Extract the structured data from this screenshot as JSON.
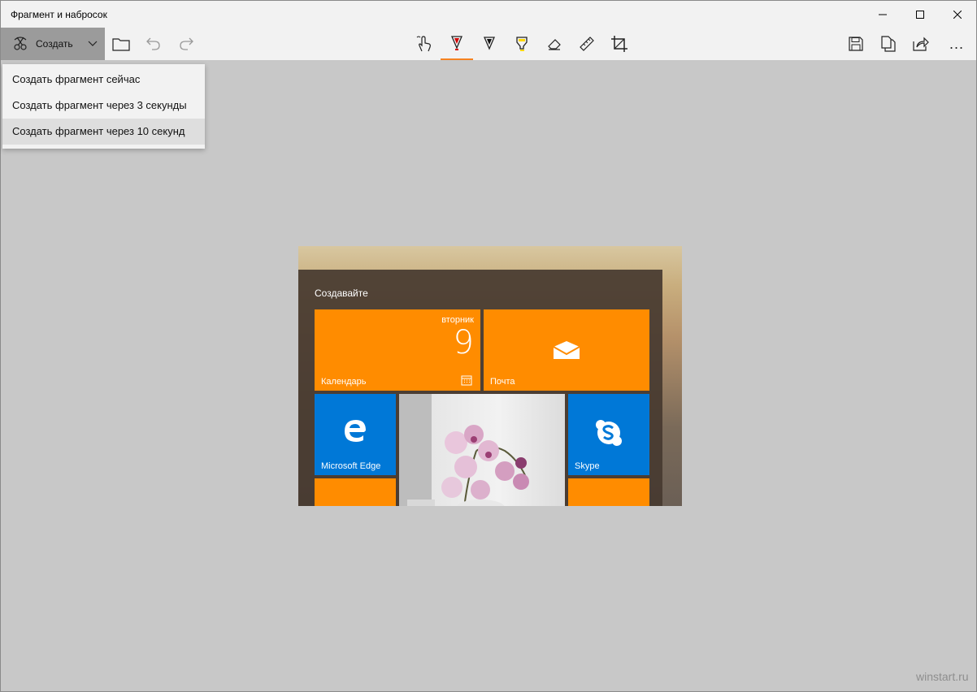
{
  "window": {
    "title": "Фрагмент и набросок"
  },
  "toolbar": {
    "create_label": "Создать",
    "more_label": "..."
  },
  "dropdown": {
    "items": [
      {
        "label": "Создать фрагмент сейчас"
      },
      {
        "label": "Создать фрагмент через 3 секунды"
      },
      {
        "label": "Создать фрагмент через 10 секунд"
      }
    ]
  },
  "snip": {
    "header": "Создавайте",
    "tiles": {
      "calendar": {
        "label": "Календарь",
        "day": "вторник",
        "date": "9"
      },
      "mail": {
        "label": "Почта"
      },
      "edge": {
        "label": "Microsoft Edge"
      },
      "skype": {
        "label": "Skype"
      }
    }
  },
  "watermark": "winstart.ru",
  "colors": {
    "accent": "#f58220",
    "tile_orange": "#ff8c00",
    "tile_blue": "#0078d7",
    "canvas_bg": "#c8c8c8"
  }
}
